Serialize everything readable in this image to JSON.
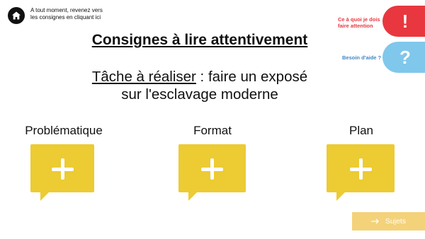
{
  "header": {
    "home_icon": "home-icon",
    "hint": "A tout moment, revenez vers les consignes en cliquant ici"
  },
  "title": "Consignes à lire attentivement",
  "task": {
    "label": "Tâche à réaliser",
    "line1_rest": " : faire un exposé",
    "line2": "sur l'esclavage moderne"
  },
  "cards": [
    {
      "label": "Problématique",
      "icon": "plus-icon"
    },
    {
      "label": "Format",
      "icon": "plus-icon"
    },
    {
      "label": "Plan",
      "icon": "plus-icon"
    }
  ],
  "side": {
    "attention_label": "Ce à quoi je dois faire attention",
    "attention_symbol": "!",
    "help_label": "Besoin d'aide ?",
    "help_symbol": "?"
  },
  "subjects_button": {
    "label": "Sujets",
    "icon": "arrow-right-icon"
  },
  "colors": {
    "accent_yellow": "#ECCB33",
    "attention_red": "#E8373F",
    "help_blue": "#80C7EC",
    "subjects_yellow": "#F3D27A"
  }
}
